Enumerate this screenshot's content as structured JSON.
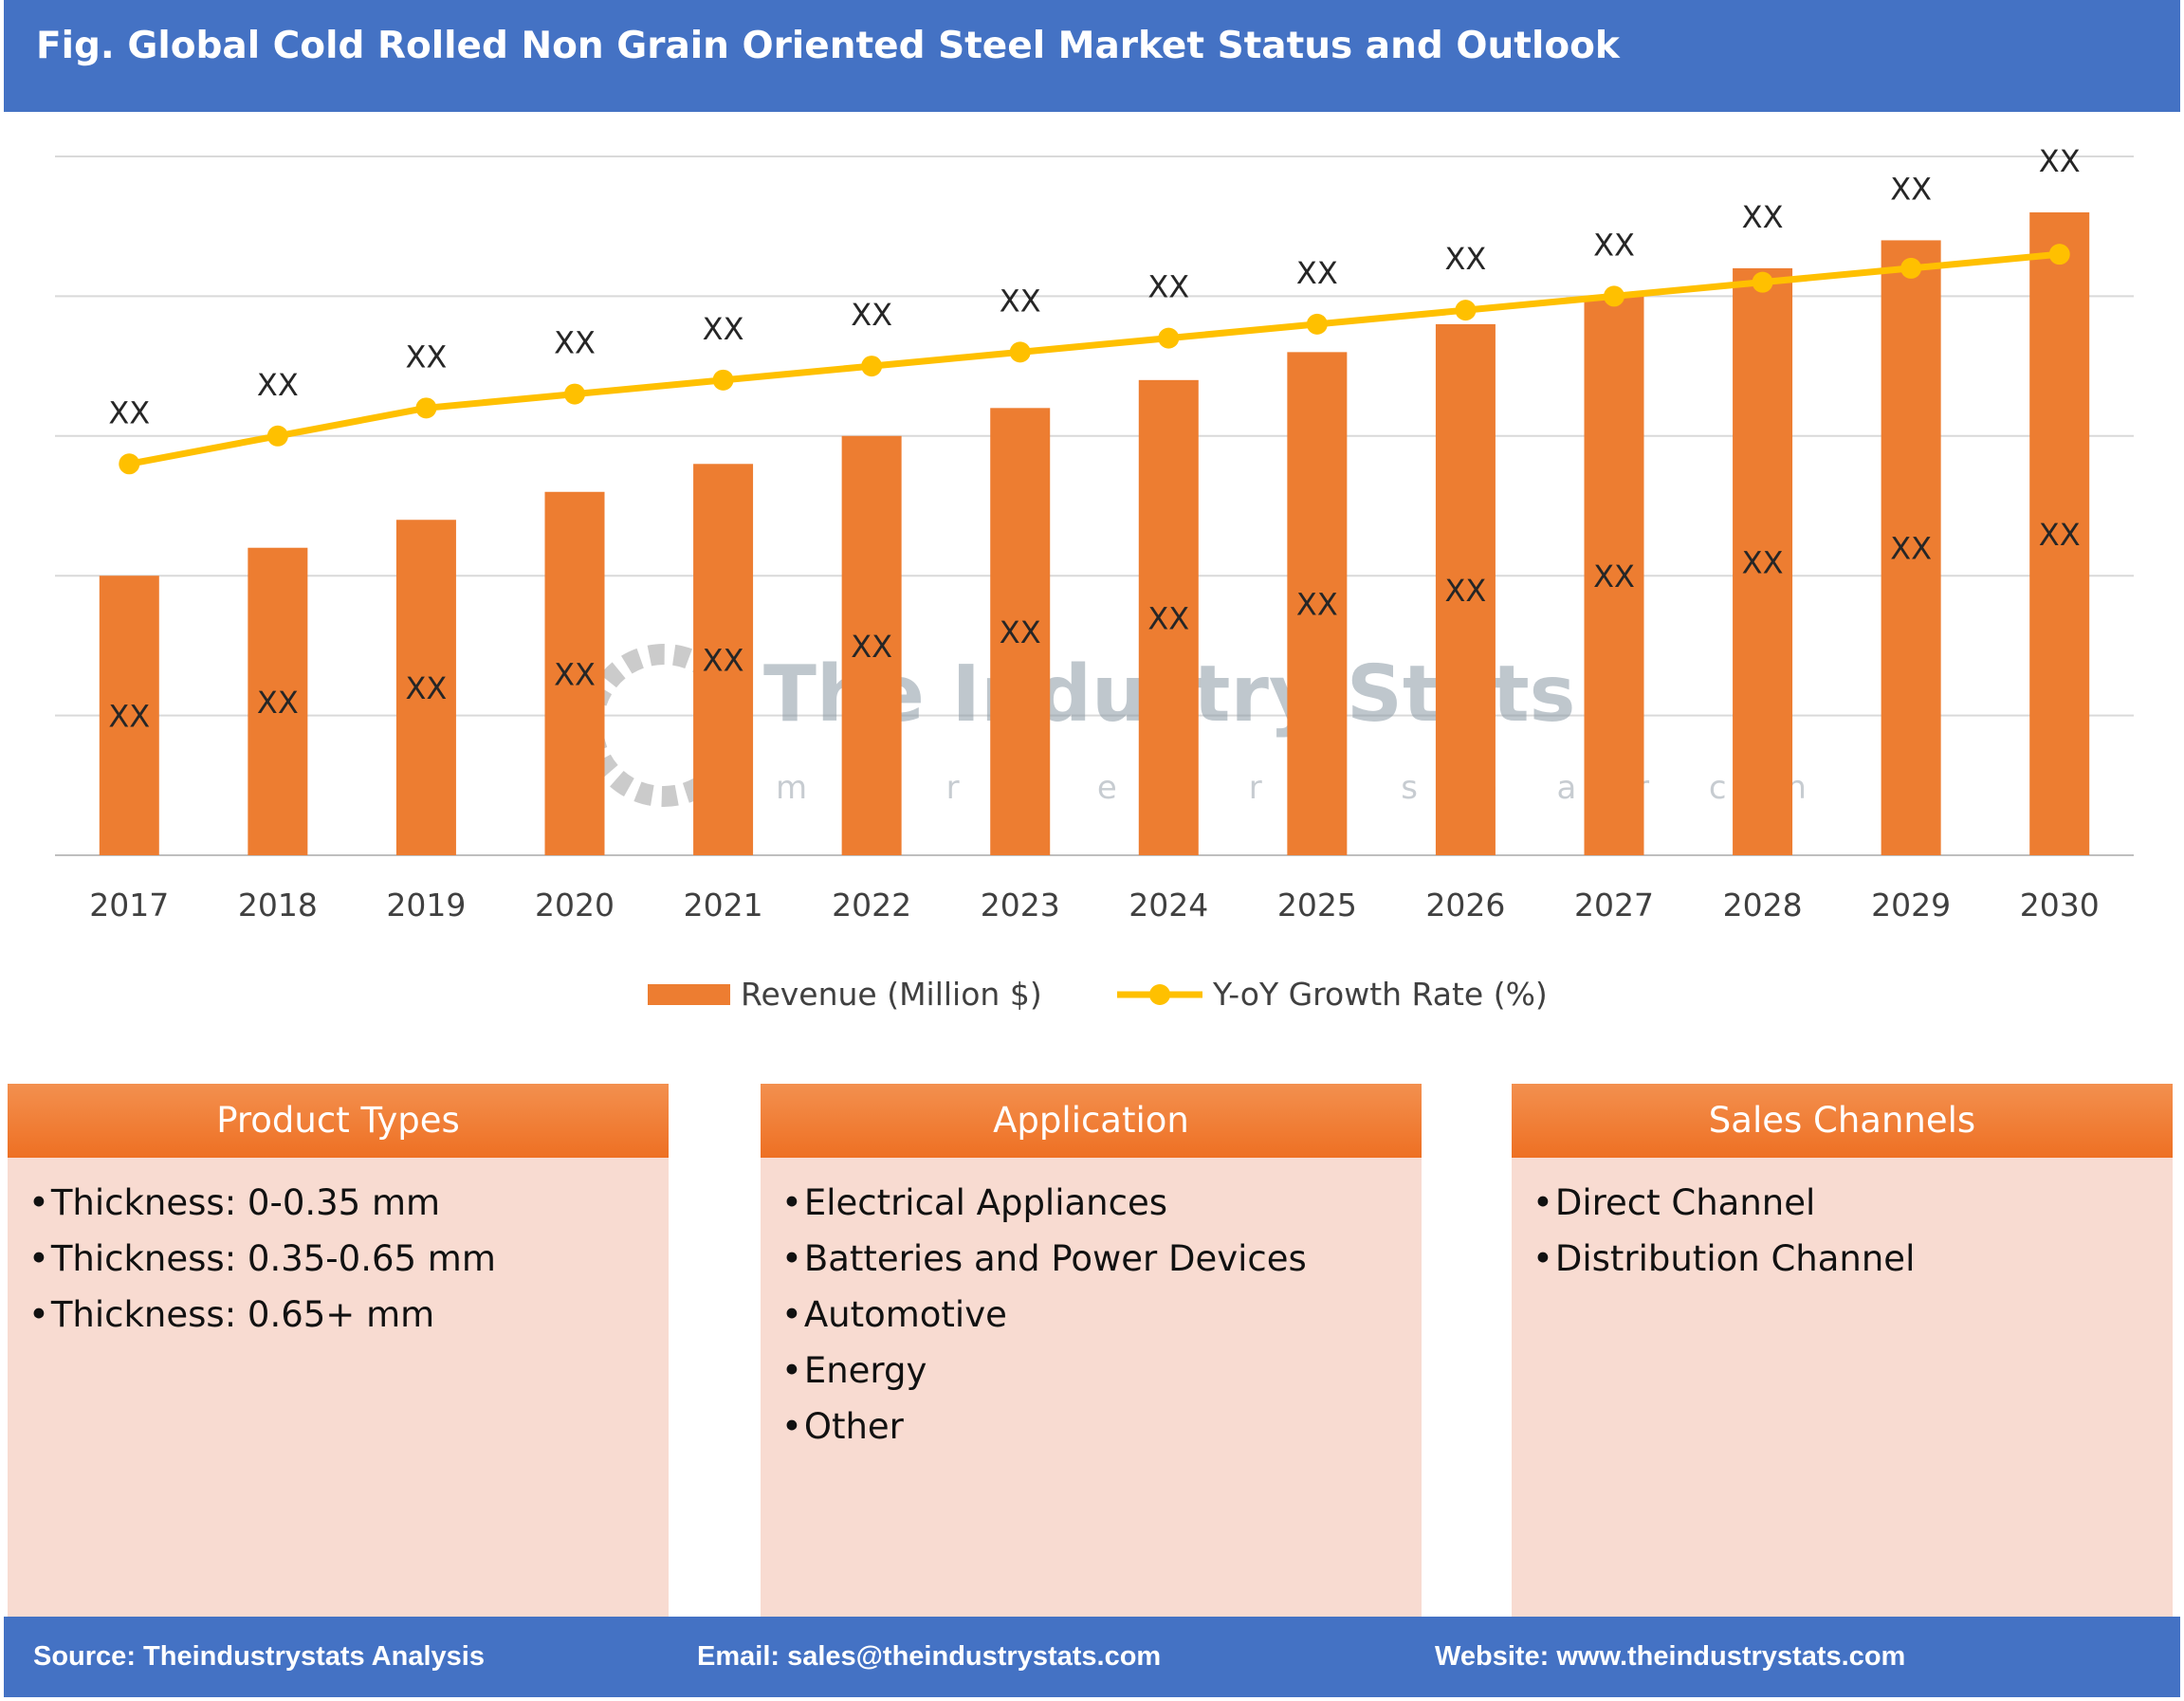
{
  "title": "Fig. Global Cold Rolled Non Grain Oriented Steel Market Status and Outlook",
  "chart_data": {
    "type": "bar",
    "categories": [
      "2017",
      "2018",
      "2019",
      "2020",
      "2021",
      "2022",
      "2023",
      "2024",
      "2025",
      "2026",
      "2027",
      "2028",
      "2029",
      "2030"
    ],
    "series": [
      {
        "name": "Revenue (Million $)",
        "type": "bar",
        "color": "#ed7d31",
        "values": [
          2.0,
          2.2,
          2.4,
          2.6,
          2.8,
          3.0,
          3.2,
          3.4,
          3.6,
          3.8,
          4.0,
          4.2,
          4.4,
          4.6
        ],
        "labels": [
          "XX",
          "XX",
          "XX",
          "XX",
          "XX",
          "XX",
          "XX",
          "XX",
          "XX",
          "XX",
          "XX",
          "XX",
          "XX",
          "XX"
        ]
      },
      {
        "name": "Y-oY Growth Rate (%)",
        "type": "line",
        "color": "#ffc000",
        "values": [
          2.8,
          3.0,
          3.2,
          3.3,
          3.4,
          3.5,
          3.6,
          3.7,
          3.8,
          3.9,
          4.0,
          4.1,
          4.2,
          4.3
        ],
        "labels": [
          "XX",
          "XX",
          "XX",
          "XX",
          "XX",
          "XX",
          "XX",
          "XX",
          "XX",
          "XX",
          "XX",
          "XX",
          "XX",
          "XX"
        ]
      }
    ],
    "ylim": [
      0,
      5
    ],
    "grid": true,
    "legend": "bottom",
    "y_tick_labels_shown": false
  },
  "watermark": {
    "name": "The Industry Stats",
    "sub": "m a r k e t   r e s e a r c h"
  },
  "cards": [
    {
      "header": "Product Types",
      "items": [
        "Thickness: 0-0.35 mm",
        "Thickness: 0.35-0.65 mm",
        "Thickness: 0.65+ mm"
      ]
    },
    {
      "header": "Application",
      "items": [
        "Electrical Appliances",
        "Batteries and Power Devices",
        "Automotive",
        "Energy",
        "Other"
      ]
    },
    {
      "header": "Sales Channels",
      "items": [
        "Direct Channel",
        "Distribution Channel"
      ]
    }
  ],
  "bullet": "•",
  "footer": {
    "source": "Source: Theindustrystats Analysis",
    "email": "Email: sales@theindustrystats.com",
    "website": "Website: www.theindustrystats.com"
  }
}
